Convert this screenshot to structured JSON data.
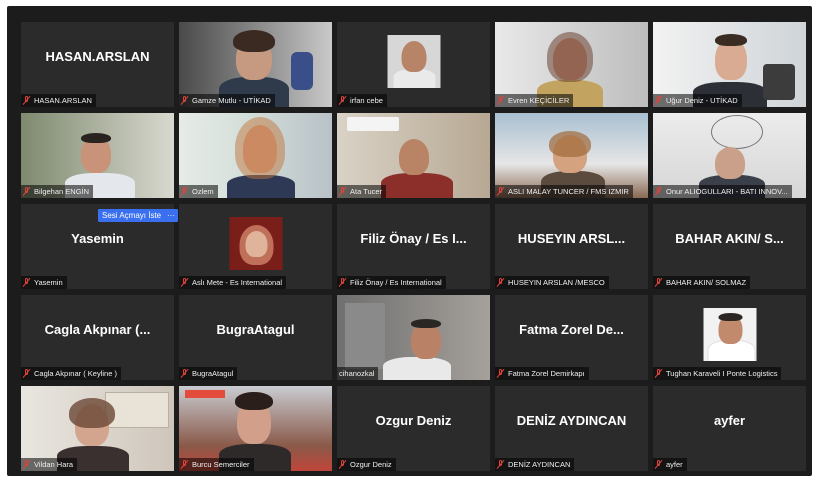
{
  "colors": {
    "background": "#1c1c1c",
    "tile": "#2b2b2b",
    "speaking_border": "#b6d36a",
    "mute": "#e0433a",
    "accent": "#3a6ff0"
  },
  "overlay": {
    "request_unmute_label": "Sesi Açmayı İste",
    "more_label": "···"
  },
  "participants": [
    {
      "name": "HASAN.ARSLAN",
      "display": "HASAN.ARSLAN",
      "muted": true
    },
    {
      "name": "Gamze Mutlu - UTİKAD",
      "muted": true
    },
    {
      "name": "irfan cebe",
      "muted": true
    },
    {
      "name": "Evren KEÇİCİLER",
      "muted": true
    },
    {
      "name": "Uğur Deniz - UTİKAD",
      "muted": true
    },
    {
      "name": "Bilgehan ENGİN",
      "muted": true
    },
    {
      "name": "Ozlem",
      "muted": true
    },
    {
      "name": "Ata Tucer",
      "muted": true
    },
    {
      "name": "ASLI MALAY TUNCER / FMS IZMIR",
      "muted": true
    },
    {
      "name": "Onur ALIOGULLARI - BATI INNOV...",
      "muted": true
    },
    {
      "name": "Yasemin",
      "display": "Yasemin",
      "muted": true
    },
    {
      "name": "Aslı Mete - Es International",
      "muted": true
    },
    {
      "name": "Filiz Önay / Es International",
      "display": "Filiz Önay / Es I...",
      "muted": true
    },
    {
      "name": "HUSEYIN ARSLAN /MESCO",
      "display": "HUSEYIN ARSL...",
      "muted": true
    },
    {
      "name": "BAHAR AKIN/ SOLMAZ",
      "display": "BAHAR AKIN/ S...",
      "muted": true
    },
    {
      "name": "Cagla Akpınar ( Keyline )",
      "display": "Cagla Akpınar (...",
      "muted": true
    },
    {
      "name": "BugraAtagul",
      "display": "BugraAtagul",
      "muted": true
    },
    {
      "name": "cihanozkal",
      "muted": false
    },
    {
      "name": "Fatma Zorel Demirkapı",
      "display": "Fatma Zorel De...",
      "muted": true
    },
    {
      "name": "Tughan Karaveli I Ponte Logistics",
      "muted": true
    },
    {
      "name": "Vildan Hara",
      "muted": true
    },
    {
      "name": "Burcu Semerciler",
      "muted": true
    },
    {
      "name": "Ozgur Deniz",
      "display": "Ozgur Deniz",
      "muted": true
    },
    {
      "name": "DENİZ AYDINCAN",
      "display": "DENİZ AYDINCAN",
      "muted": true
    },
    {
      "name": "ayfer",
      "display": "ayfer",
      "muted": true
    }
  ]
}
